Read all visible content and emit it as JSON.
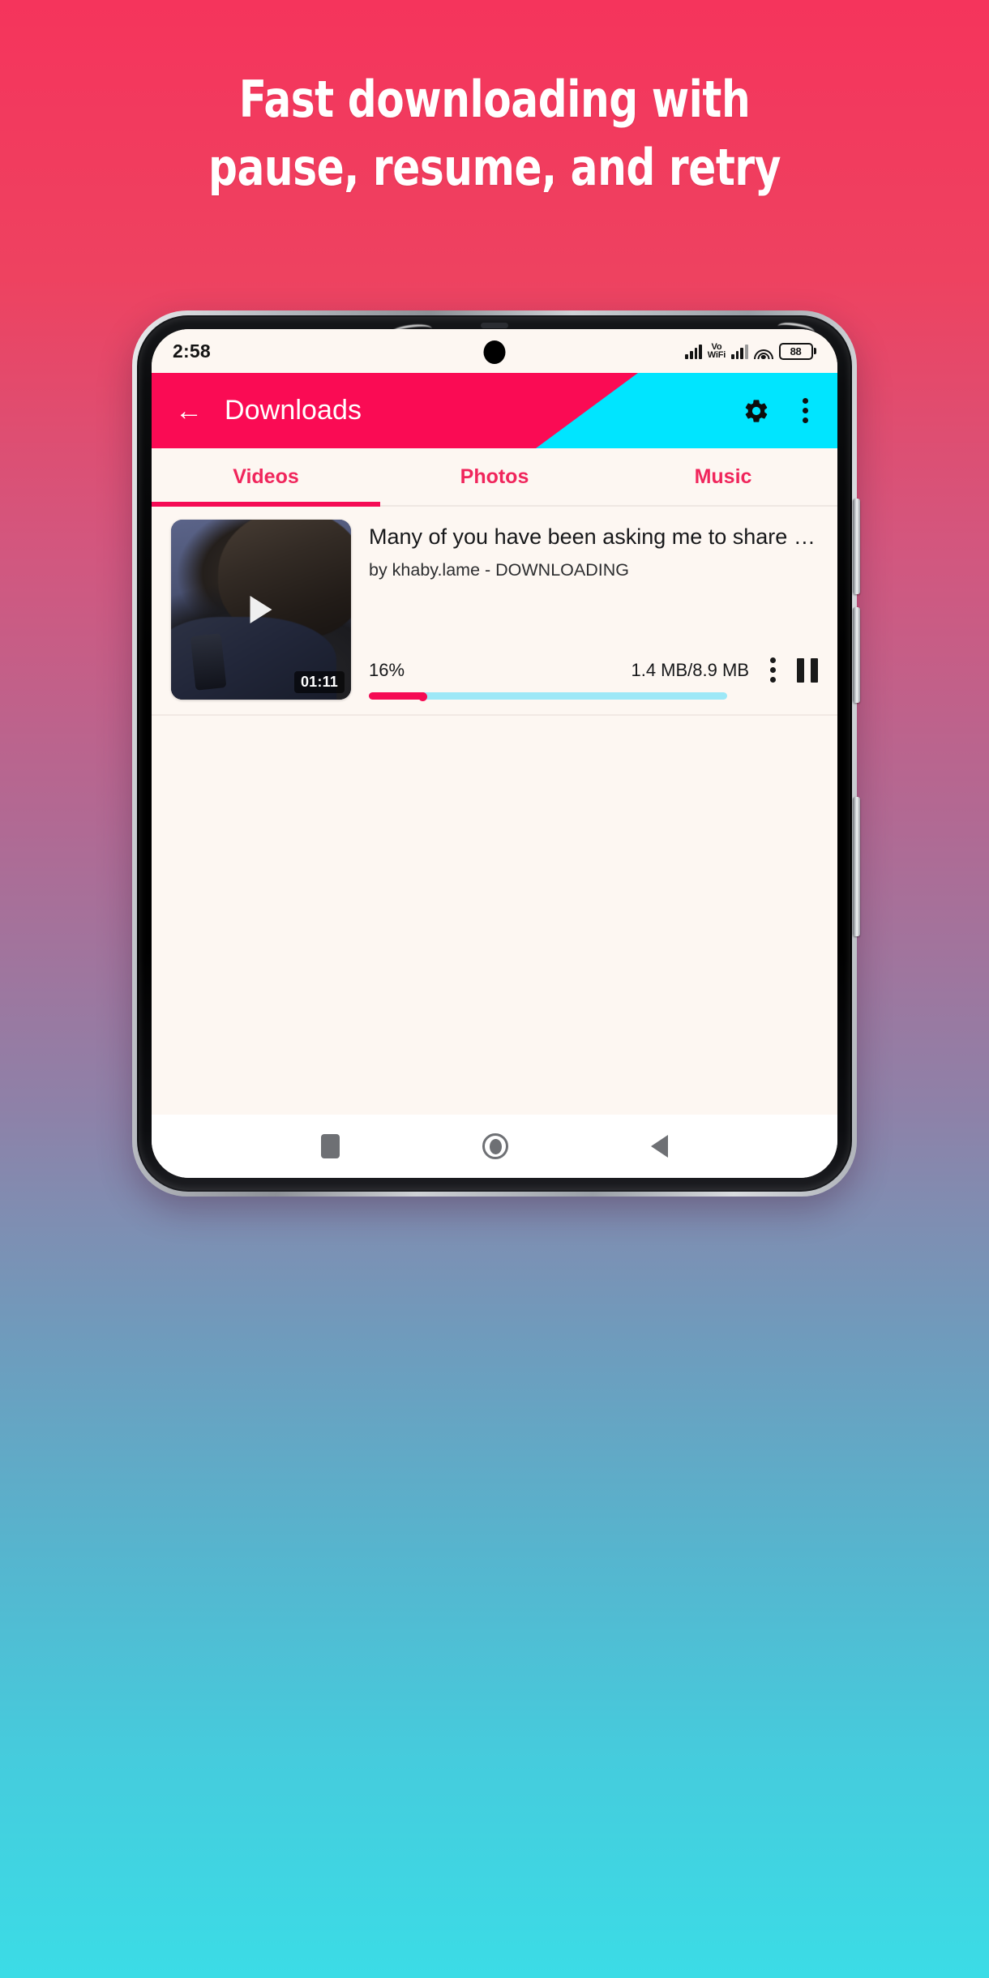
{
  "promo": {
    "headline_line1": "Fast downloading with",
    "headline_line2": "pause, resume, and retry",
    "background_top_color": "#F5345C",
    "background_bottom_color": "#3BDCE6"
  },
  "statusbar": {
    "clock": "2:58",
    "volte_line1": "Vo",
    "volte_line2": "WiFi",
    "battery_level": "88",
    "icons": [
      "signal-bars-icon",
      "vowifi-icon",
      "signal-bars-icon",
      "wifi-icon",
      "battery-icon"
    ]
  },
  "appbar": {
    "back_icon": "←",
    "title": "Downloads",
    "settings_icon": "gear-icon",
    "overflow_icon": "kebab-menu-icon",
    "pink_color": "#FA0B54",
    "cyan_color": "#00E5FF"
  },
  "tabs": {
    "items": [
      {
        "label": "Videos",
        "active": true
      },
      {
        "label": "Photos",
        "active": false
      },
      {
        "label": "Music",
        "active": false
      }
    ],
    "accent_color": "#F50B54"
  },
  "downloads": [
    {
      "title": "Many of you have been asking me to share s…",
      "subtitle": "by khaby.lame - DOWNLOADING",
      "duration": "01:11",
      "percent_label": "16%",
      "percent_value": 16,
      "size_label": "1.4 MB/8.9 MB",
      "overflow_icon": "kebab-menu-icon",
      "action_icon": "pause-icon",
      "progress_fill_color": "#F50B54",
      "progress_track_color": "#9DE8F7"
    }
  ],
  "navbar": {
    "items": [
      {
        "icon": "recents-square-icon"
      },
      {
        "icon": "home-circle-icon"
      },
      {
        "icon": "back-triangle-icon"
      }
    ]
  }
}
